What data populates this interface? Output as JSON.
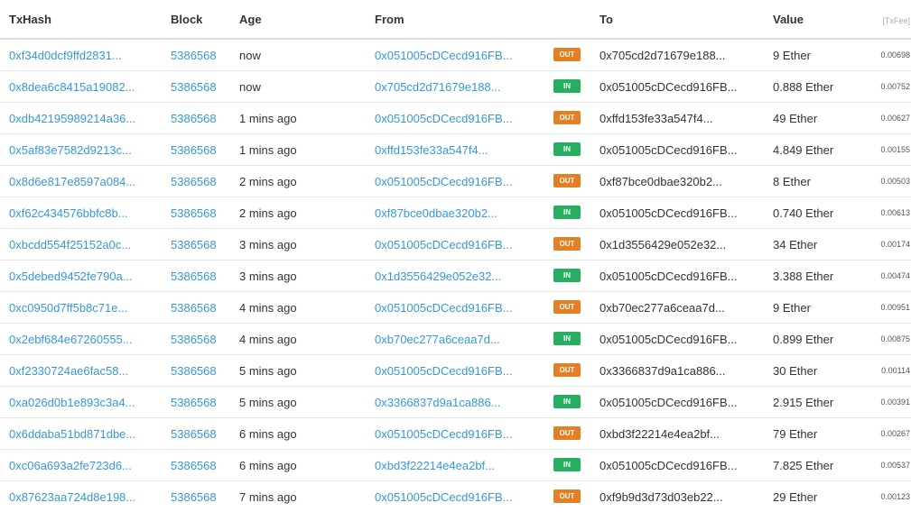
{
  "columns": {
    "txhash": "TxHash",
    "block": "Block",
    "age": "Age",
    "from": "From",
    "to": "To",
    "value": "Value",
    "txfee": "[TxFee]"
  },
  "colors": {
    "link": "#3498db",
    "out_badge": "#e67e22",
    "in_badge": "#27ae60"
  },
  "rows": [
    {
      "hash": "0xf34d0dcf9ffd2831...",
      "block": "5386568",
      "age": "now",
      "from": "0x051005cDCecd916FB...",
      "dir": "OUT",
      "to": "0x705cd2d71679e188...",
      "value": "9 Ether",
      "fee": "0.00698"
    },
    {
      "hash": "0x8dea6c8415a19082...",
      "block": "5386568",
      "age": "now",
      "from": "0x705cd2d71679e188...",
      "dir": "IN",
      "to": "0x051005cDCecd916FB...",
      "value": "0.888 Ether",
      "fee": "0.00752"
    },
    {
      "hash": "0xdb42195989214a36...",
      "block": "5386568",
      "age": "1 mins ago",
      "from": "0x051005cDCecd916FB...",
      "dir": "OUT",
      "to": "0xffd153fe33a547f4...",
      "value": "49 Ether",
      "fee": "0.00627"
    },
    {
      "hash": "0x5af83e7582d9213c...",
      "block": "5386568",
      "age": "1 mins ago",
      "from": "0xffd153fe33a547f4...",
      "dir": "IN",
      "to": "0x051005cDCecd916FB...",
      "value": "4.849 Ether",
      "fee": "0.00155"
    },
    {
      "hash": "0x8d6e817e8597a084...",
      "block": "5386568",
      "age": "2 mins ago",
      "from": "0x051005cDCecd916FB...",
      "dir": "OUT",
      "to": "0xf87bce0dbae320b2...",
      "value": "8 Ether",
      "fee": "0.00503"
    },
    {
      "hash": "0xf62c434576bbfc8b...",
      "block": "5386568",
      "age": "2 mins ago",
      "from": "0xf87bce0dbae320b2...",
      "dir": "IN",
      "to": "0x051005cDCecd916FB...",
      "value": "0.740 Ether",
      "fee": "0.00613"
    },
    {
      "hash": "0xbcdd554f25152a0c...",
      "block": "5386568",
      "age": "3 mins ago",
      "from": "0x051005cDCecd916FB...",
      "dir": "OUT",
      "to": "0x1d3556429e052e32...",
      "value": "34 Ether",
      "fee": "0.00174"
    },
    {
      "hash": "0x5debed9452fe790a...",
      "block": "5386568",
      "age": "3 mins ago",
      "from": "0x1d3556429e052e32...",
      "dir": "IN",
      "to": "0x051005cDCecd916FB...",
      "value": "3.388 Ether",
      "fee": "0.00474"
    },
    {
      "hash": "0xc0950d7ff5b8c71e...",
      "block": "5386568",
      "age": "4 mins ago",
      "from": "0x051005cDCecd916FB...",
      "dir": "OUT",
      "to": "0xb70ec277a6ceaa7d...",
      "value": "9 Ether",
      "fee": "0.00951"
    },
    {
      "hash": "0x2ebf684e67260555...",
      "block": "5386568",
      "age": "4 mins ago",
      "from": "0xb70ec277a6ceaa7d...",
      "dir": "IN",
      "to": "0x051005cDCecd916FB...",
      "value": "0.899 Ether",
      "fee": "0.00875"
    },
    {
      "hash": "0xf2330724ae6fac58...",
      "block": "5386568",
      "age": "5 mins ago",
      "from": "0x051005cDCecd916FB...",
      "dir": "OUT",
      "to": "0x3366837d9a1ca886...",
      "value": "30 Ether",
      "fee": "0.00114"
    },
    {
      "hash": "0xa026d0b1e893c3a4...",
      "block": "5386568",
      "age": "5 mins ago",
      "from": "0x3366837d9a1ca886...",
      "dir": "IN",
      "to": "0x051005cDCecd916FB...",
      "value": "2.915 Ether",
      "fee": "0.00391"
    },
    {
      "hash": "0x6ddaba51bd871dbe...",
      "block": "5386568",
      "age": "6 mins ago",
      "from": "0x051005cDCecd916FB...",
      "dir": "OUT",
      "to": "0xbd3f22214e4ea2bf...",
      "value": "79 Ether",
      "fee": "0.00267"
    },
    {
      "hash": "0xc06a693a2fe723d6...",
      "block": "5386568",
      "age": "6 mins ago",
      "from": "0xbd3f22214e4ea2bf...",
      "dir": "IN",
      "to": "0x051005cDCecd916FB...",
      "value": "7.825 Ether",
      "fee": "0.00537"
    },
    {
      "hash": "0x87623aa724d8e198...",
      "block": "5386568",
      "age": "7 mins ago",
      "from": "0x051005cDCecd916FB...",
      "dir": "OUT",
      "to": "0xf9b9d3d73d03eb22...",
      "value": "29 Ether",
      "fee": "0.00123"
    }
  ]
}
